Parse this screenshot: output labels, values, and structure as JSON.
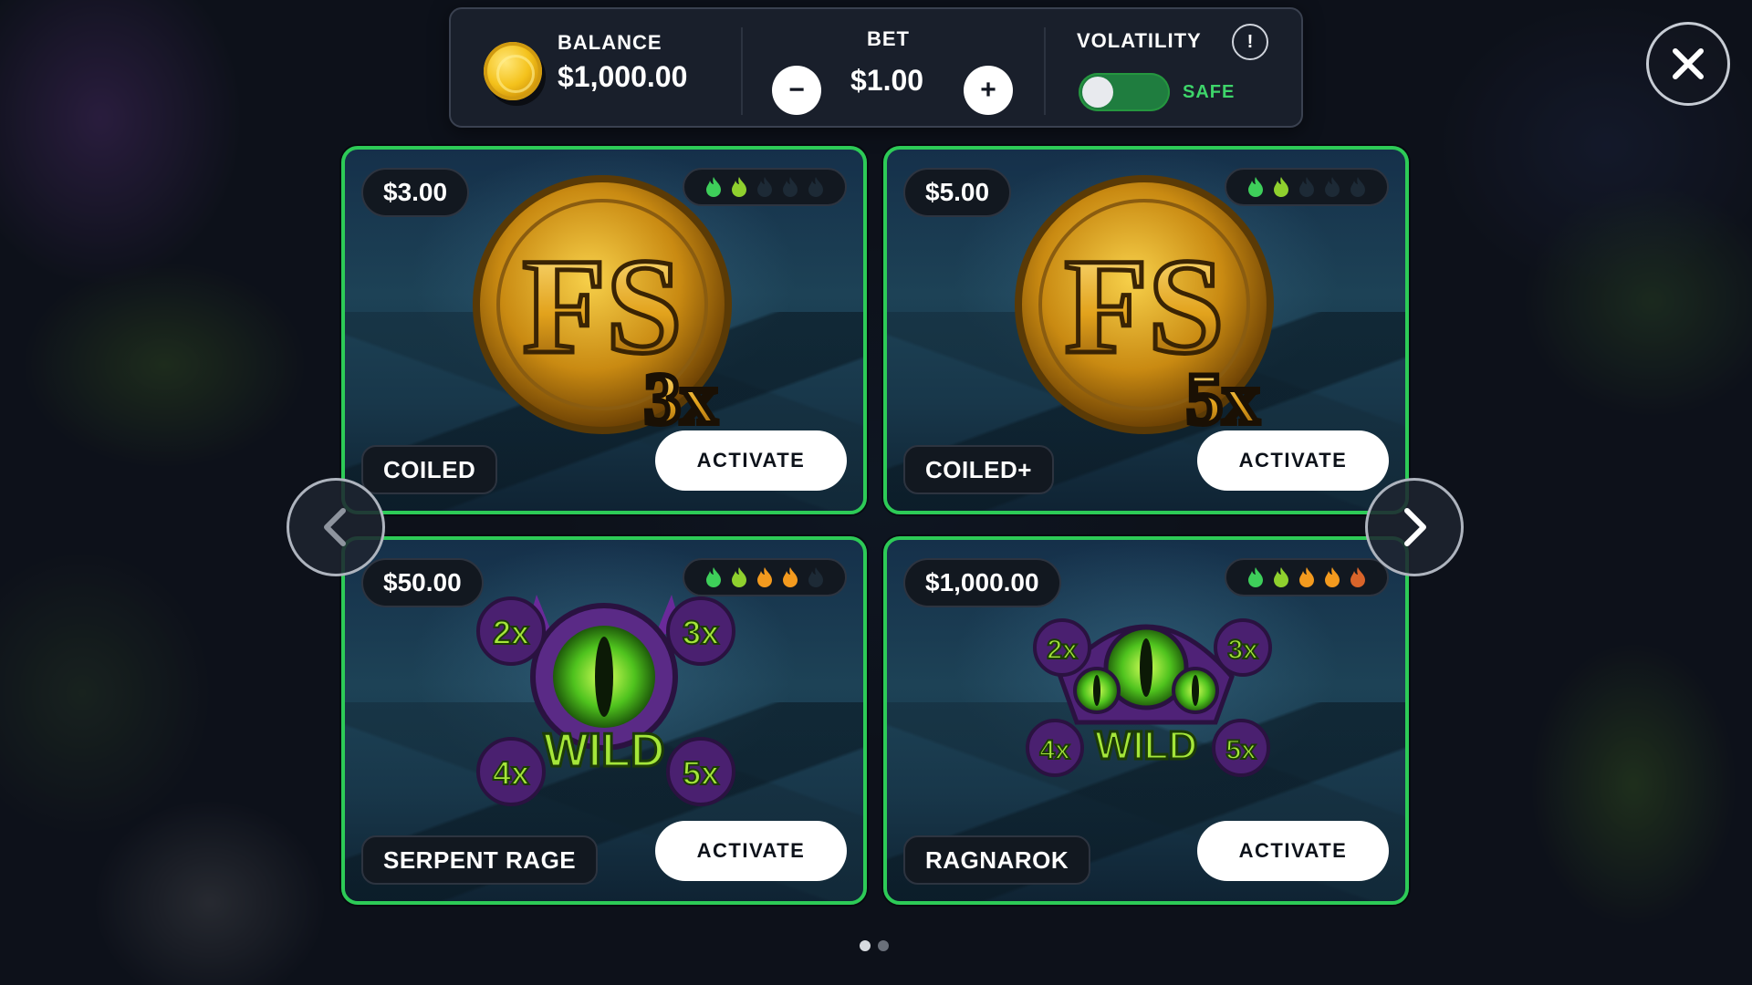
{
  "header": {
    "balance_label": "BALANCE",
    "balance_value": "$1,000.00",
    "bet_label": "BET",
    "bet_value": "$1.00",
    "bet_decrease_label": "−",
    "bet_increase_label": "+",
    "volatility_label": "VOLATILITY",
    "volatility_info_label": "!",
    "volatility_mode": "SAFE",
    "volatility_toggle_on": false
  },
  "colors": {
    "accent_green": "#2dcb57",
    "flame_green": "#3ecf5a",
    "flame_lime": "#8fd02e",
    "flame_orange": "#f39a1e",
    "flame_red": "#d9642a",
    "flame_off": "#1d2a36"
  },
  "cards": [
    {
      "price": "$3.00",
      "name": "COILED",
      "button": "ACTIVATE",
      "art": "fs-3x",
      "art_multiplier": "3x",
      "flames": [
        "green",
        "lime",
        "off",
        "off",
        "off"
      ]
    },
    {
      "price": "$5.00",
      "name": "COILED+",
      "button": "ACTIVATE",
      "art": "fs-5x",
      "art_multiplier": "5x",
      "flames": [
        "green",
        "lime",
        "off",
        "off",
        "off"
      ]
    },
    {
      "price": "$50.00",
      "name": "SERPENT RAGE",
      "button": "ACTIVATE",
      "art": "wild-single-eye",
      "art_wild": "WILD",
      "art_multipliers": [
        "2x",
        "3x",
        "4x",
        "5x"
      ],
      "flames": [
        "green",
        "lime",
        "orange",
        "orange",
        "off"
      ]
    },
    {
      "price": "$1,000.00",
      "name": "RAGNAROK",
      "button": "ACTIVATE",
      "art": "wild-triple-eye",
      "art_wild": "WILD",
      "art_multipliers": [
        "2x",
        "3x",
        "4x",
        "5x"
      ],
      "flames": [
        "green",
        "lime",
        "orange",
        "orange",
        "red"
      ]
    }
  ],
  "pagination": {
    "pages": 2,
    "current": 1
  },
  "icons": {
    "close": "close-icon",
    "prev": "chevron-left-icon",
    "next": "chevron-right-icon",
    "coin": "coin-icon",
    "flame": "flame-icon"
  }
}
